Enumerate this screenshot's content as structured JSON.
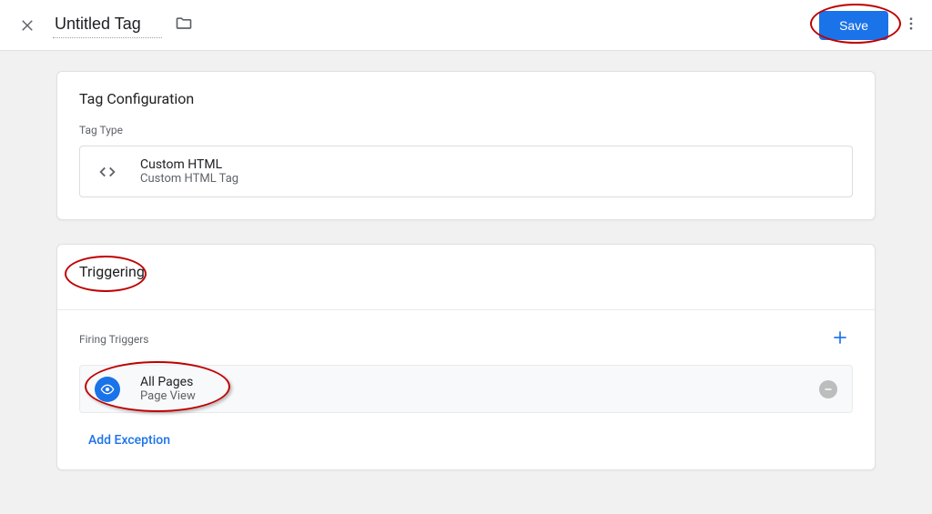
{
  "header": {
    "title": "Untitled Tag",
    "save_label": "Save"
  },
  "config": {
    "card_title": "Tag Configuration",
    "section_label": "Tag Type",
    "type_name": "Custom HTML",
    "type_desc": "Custom HTML Tag"
  },
  "triggering": {
    "card_title": "Triggering",
    "section_label": "Firing Triggers",
    "trigger_name": "All Pages",
    "trigger_type": "Page View",
    "add_exception_label": "Add Exception"
  }
}
